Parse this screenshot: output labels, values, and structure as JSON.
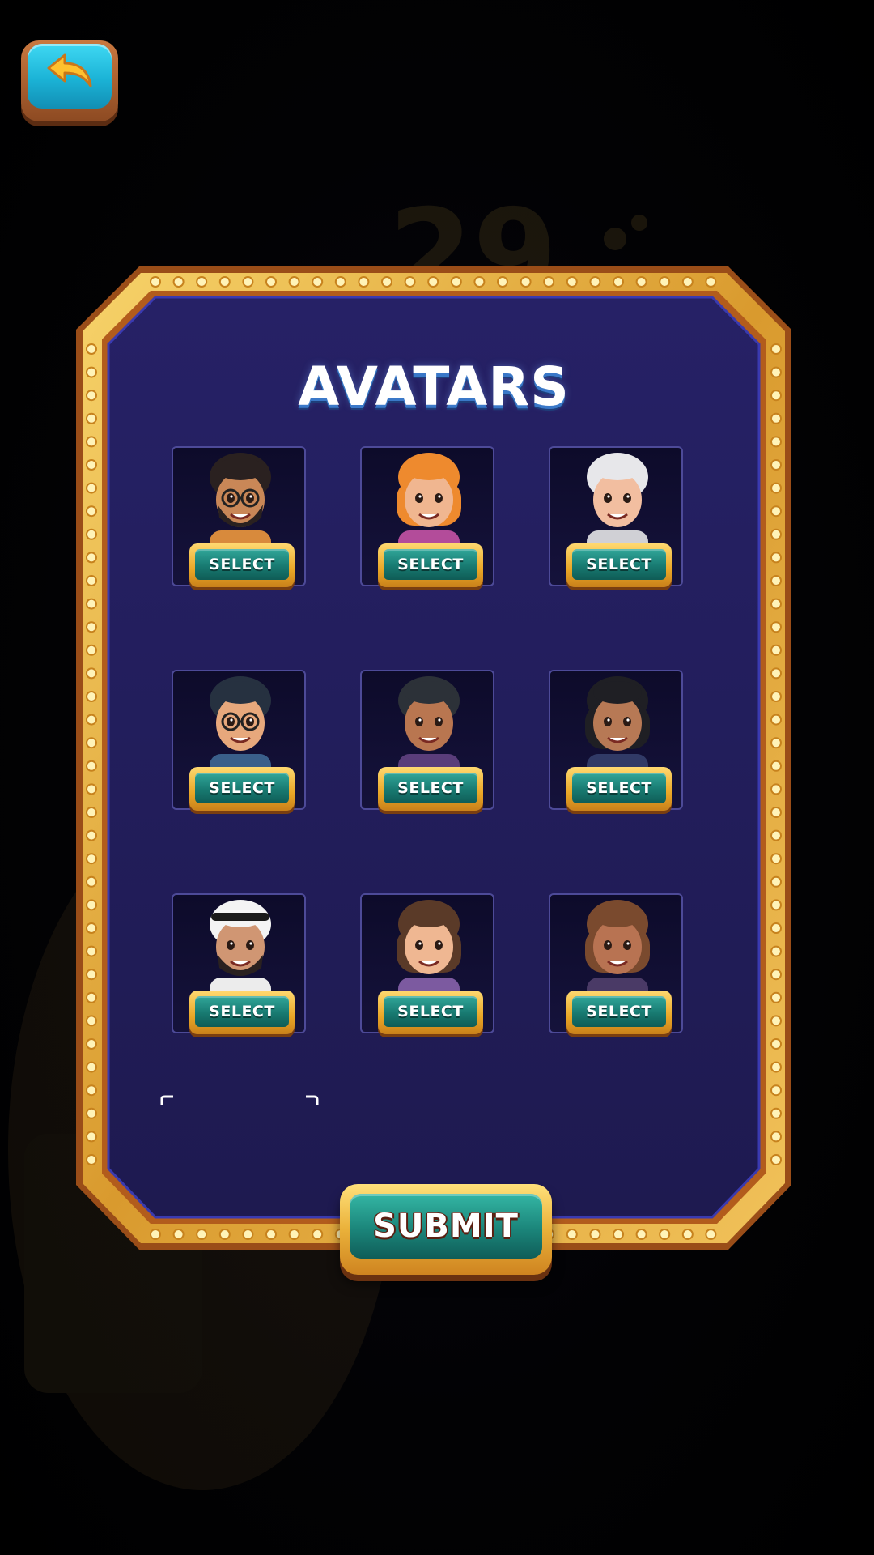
{
  "screen": {
    "title": "AVATARS"
  },
  "avatars": [
    {
      "icon": "avatar-man-beard-glasses-icon",
      "select_label": "SELECT",
      "skin": "#c98757",
      "hair": "#2a2120",
      "shirt": "#d88a3c"
    },
    {
      "icon": "avatar-woman-orange-hair-icon",
      "select_label": "SELECT",
      "skin": "#f0b690",
      "hair": "#ee8a2e",
      "shirt": "#b34c9a"
    },
    {
      "icon": "avatar-woman-white-hood-icon",
      "select_label": "SELECT",
      "skin": "#f2bea0",
      "hair": "#e7e7ea",
      "shirt": "#d0d0d5"
    },
    {
      "icon": "avatar-young-man-glasses-icon",
      "select_label": "SELECT",
      "skin": "#e7a87c",
      "hair": "#263140",
      "shirt": "#3a5f8a"
    },
    {
      "icon": "avatar-woman-dark-bob-icon",
      "select_label": "SELECT",
      "skin": "#b97650",
      "hair": "#2c3138",
      "shirt": "#5a3d7a"
    },
    {
      "icon": "avatar-woman-black-hair-icon",
      "select_label": "SELECT",
      "skin": "#b77955",
      "hair": "#1f1f24",
      "shirt": "#313a66"
    },
    {
      "icon": "avatar-man-keffiyeh-icon",
      "select_label": "SELECT",
      "skin": "#d09673",
      "hair": "#f4f4f4",
      "shirt": "#ececec"
    },
    {
      "icon": "avatar-woman-brown-hair-icon",
      "select_label": "SELECT",
      "skin": "#efb792",
      "hair": "#5a3a28",
      "shirt": "#7c5aa0"
    },
    {
      "icon": "avatar-woman-auburn-hair-icon",
      "select_label": "SELECT",
      "skin": "#b87352",
      "hair": "#7a4a2e",
      "shirt": "#4a3a66"
    }
  ],
  "submit": {
    "label": "SUBMIT"
  },
  "colors": {
    "panel_fill": "#221d5c",
    "frame_gold": "#e8b040",
    "frame_copper": "#b8621e",
    "button_teal": "#1b857a",
    "back_button_cyan": "#1bb3d6"
  }
}
